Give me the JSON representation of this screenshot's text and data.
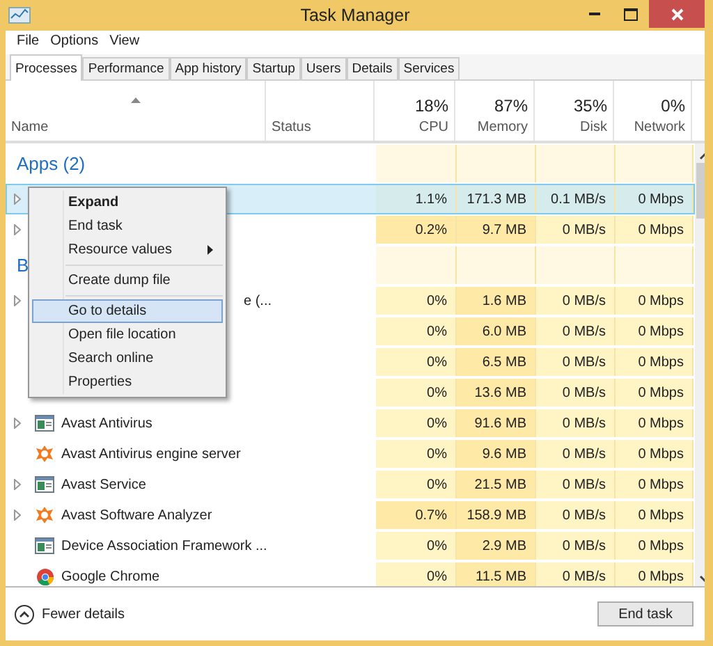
{
  "window": {
    "title": "Task Manager"
  },
  "menu_bar": [
    "File",
    "Options",
    "View"
  ],
  "tabs": [
    {
      "label": "Processes",
      "selected": true
    },
    {
      "label": "Performance",
      "selected": false
    },
    {
      "label": "App history",
      "selected": false
    },
    {
      "label": "Startup",
      "selected": false
    },
    {
      "label": "Users",
      "selected": false
    },
    {
      "label": "Details",
      "selected": false
    },
    {
      "label": "Services",
      "selected": false
    }
  ],
  "table": {
    "columns": [
      {
        "label": "Name"
      },
      {
        "label": "Status"
      },
      {
        "label": "CPU",
        "total": "18%"
      },
      {
        "label": "Memory",
        "total": "87%"
      },
      {
        "label": "Disk",
        "total": "35%"
      },
      {
        "label": "Network",
        "total": "0%"
      }
    ],
    "rows": [
      {
        "kind": "group",
        "title": "Apps (2)"
      },
      {
        "kind": "covered",
        "expandable": true,
        "selected": true,
        "cells": [
          {
            "text": "1.1%",
            "hot": false
          },
          {
            "text": "171.3 MB",
            "hot": false
          },
          {
            "text": "0.1 MB/s",
            "hot": false
          },
          {
            "text": "0 Mbps",
            "hot": false
          }
        ]
      },
      {
        "kind": "covered",
        "expandable": true,
        "selected": false,
        "cells": [
          {
            "text": "0.2%",
            "hot": true
          },
          {
            "text": "9.7 MB",
            "hot": true
          },
          {
            "text": "0 MB/s",
            "hot": false
          },
          {
            "text": "0 Mbps",
            "hot": false
          }
        ]
      },
      {
        "kind": "group",
        "title": "B"
      },
      {
        "kind": "covered",
        "expandable": true,
        "selected": false,
        "name": "e (...",
        "cells": [
          {
            "text": "0%",
            "hot": false
          },
          {
            "text": "1.6 MB",
            "hot": true
          },
          {
            "text": "0 MB/s",
            "hot": false
          },
          {
            "text": "0 Mbps",
            "hot": false
          }
        ]
      },
      {
        "kind": "covered",
        "expandable": false,
        "selected": false,
        "cells": [
          {
            "text": "0%",
            "hot": false
          },
          {
            "text": "6.0 MB",
            "hot": true
          },
          {
            "text": "0 MB/s",
            "hot": false
          },
          {
            "text": "0 Mbps",
            "hot": false
          }
        ]
      },
      {
        "kind": "covered",
        "expandable": false,
        "selected": false,
        "cells": [
          {
            "text": "0%",
            "hot": false
          },
          {
            "text": "6.5 MB",
            "hot": true
          },
          {
            "text": "0 MB/s",
            "hot": false
          },
          {
            "text": "0 Mbps",
            "hot": false
          }
        ]
      },
      {
        "kind": "covered",
        "expandable": false,
        "selected": false,
        "cells": [
          {
            "text": "0%",
            "hot": false
          },
          {
            "text": "13.6 MB",
            "hot": true
          },
          {
            "text": "0 MB/s",
            "hot": false
          },
          {
            "text": "0 Mbps",
            "hot": false
          }
        ]
      },
      {
        "kind": "window",
        "expandable": true,
        "selected": false,
        "name": "Avast Antivirus",
        "cells": [
          {
            "text": "0%",
            "hot": false
          },
          {
            "text": "91.6 MB",
            "hot": true
          },
          {
            "text": "0 MB/s",
            "hot": false
          },
          {
            "text": "0 Mbps",
            "hot": false
          }
        ]
      },
      {
        "kind": "splat",
        "expandable": false,
        "selected": false,
        "name": "Avast Antivirus engine server",
        "cells": [
          {
            "text": "0%",
            "hot": false
          },
          {
            "text": "9.6 MB",
            "hot": true
          },
          {
            "text": "0 MB/s",
            "hot": false
          },
          {
            "text": "0 Mbps",
            "hot": false
          }
        ]
      },
      {
        "kind": "window",
        "expandable": true,
        "selected": false,
        "name": "Avast Service",
        "cells": [
          {
            "text": "0%",
            "hot": false
          },
          {
            "text": "21.5 MB",
            "hot": true
          },
          {
            "text": "0 MB/s",
            "hot": false
          },
          {
            "text": "0 Mbps",
            "hot": false
          }
        ]
      },
      {
        "kind": "splat",
        "expandable": true,
        "selected": false,
        "name": "Avast Software Analyzer",
        "cells": [
          {
            "text": "0.7%",
            "hot": true
          },
          {
            "text": "158.9 MB",
            "hot": true
          },
          {
            "text": "0 MB/s",
            "hot": false
          },
          {
            "text": "0 Mbps",
            "hot": false
          }
        ]
      },
      {
        "kind": "window",
        "expandable": false,
        "selected": false,
        "name": "Device Association Framework ...",
        "cells": [
          {
            "text": "0%",
            "hot": false
          },
          {
            "text": "2.9 MB",
            "hot": true
          },
          {
            "text": "0 MB/s",
            "hot": false
          },
          {
            "text": "0 Mbps",
            "hot": false
          }
        ]
      },
      {
        "kind": "browser",
        "expandable": false,
        "selected": false,
        "name": "Google Chrome",
        "cells": [
          {
            "text": "0%",
            "hot": false
          },
          {
            "text": "11.5 MB",
            "hot": true
          },
          {
            "text": "0 MB/s",
            "hot": false
          },
          {
            "text": "0 Mbps",
            "hot": false
          }
        ]
      }
    ]
  },
  "context_menu": [
    {
      "kind": "item",
      "label": "Expand",
      "default": true,
      "submenu": false,
      "selected": false
    },
    {
      "kind": "item",
      "label": "End task",
      "default": false,
      "submenu": false,
      "selected": false
    },
    {
      "kind": "item",
      "label": "Resource values",
      "default": false,
      "submenu": true,
      "selected": false
    },
    {
      "kind": "separator"
    },
    {
      "kind": "item",
      "label": "Create dump file",
      "default": false,
      "submenu": false,
      "selected": false
    },
    {
      "kind": "separator"
    },
    {
      "kind": "item",
      "label": "Go to details",
      "default": false,
      "submenu": false,
      "selected": true
    },
    {
      "kind": "item",
      "label": "Open file location",
      "default": false,
      "submenu": false,
      "selected": false
    },
    {
      "kind": "item",
      "label": "Search online",
      "default": false,
      "submenu": false,
      "selected": false
    },
    {
      "kind": "item",
      "label": "Properties",
      "default": false,
      "submenu": false,
      "selected": false
    }
  ],
  "footer": {
    "toggle": "Fewer details",
    "button": "End task"
  }
}
